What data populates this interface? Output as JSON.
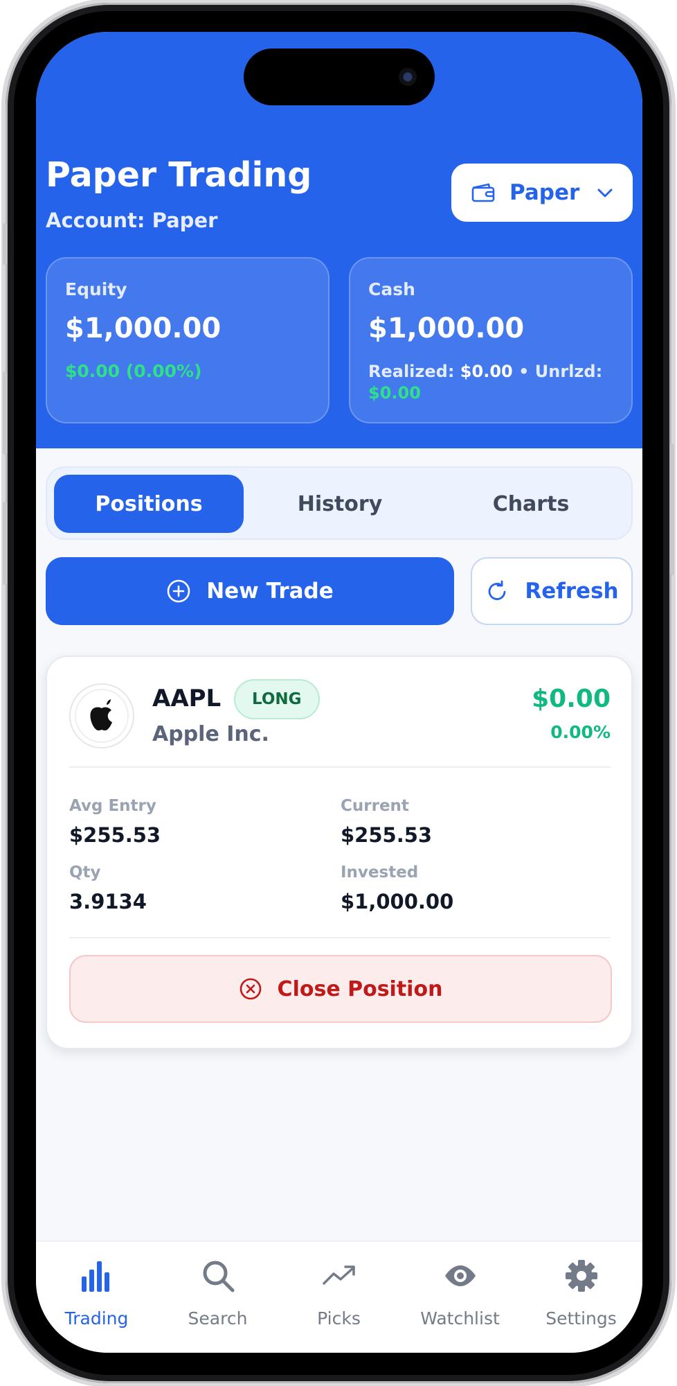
{
  "header": {
    "title": "Paper Trading",
    "account_line": "Account: Paper",
    "account_selector": "Paper"
  },
  "cards": {
    "equity": {
      "label": "Equity",
      "value": "$1,000.00",
      "change": "$0.00 (0.00%)"
    },
    "cash": {
      "label": "Cash",
      "value": "$1,000.00",
      "realized_label": "Realized:",
      "realized_value": "$0.00",
      "separator": "•",
      "unrealized_label": "Unrlzd:",
      "unrealized_value": "$0.00"
    }
  },
  "tabs": [
    {
      "label": "Positions",
      "active": true
    },
    {
      "label": "History",
      "active": false
    },
    {
      "label": "Charts",
      "active": false
    }
  ],
  "actions": {
    "new_trade": "New Trade",
    "refresh": "Refresh"
  },
  "position": {
    "ticker": "AAPL",
    "side": "LONG",
    "company": "Apple Inc.",
    "pnl": "$0.00",
    "pnl_pct": "0.00%",
    "avg_entry_label": "Avg Entry",
    "avg_entry": "$255.53",
    "current_label": "Current",
    "current": "$255.53",
    "qty_label": "Qty",
    "qty": "3.9134",
    "invested_label": "Invested",
    "invested": "$1,000.00",
    "close_label": "Close Position"
  },
  "nav": [
    {
      "label": "Trading",
      "icon": "bar-chart-icon",
      "active": true
    },
    {
      "label": "Search",
      "icon": "search-icon",
      "active": false
    },
    {
      "label": "Picks",
      "icon": "trending-up-icon",
      "active": false
    },
    {
      "label": "Watchlist",
      "icon": "eye-icon",
      "active": false
    },
    {
      "label": "Settings",
      "icon": "gear-icon",
      "active": false
    }
  ],
  "colors": {
    "primary": "#2563eb",
    "positive": "#10b981",
    "danger": "#c01919"
  }
}
